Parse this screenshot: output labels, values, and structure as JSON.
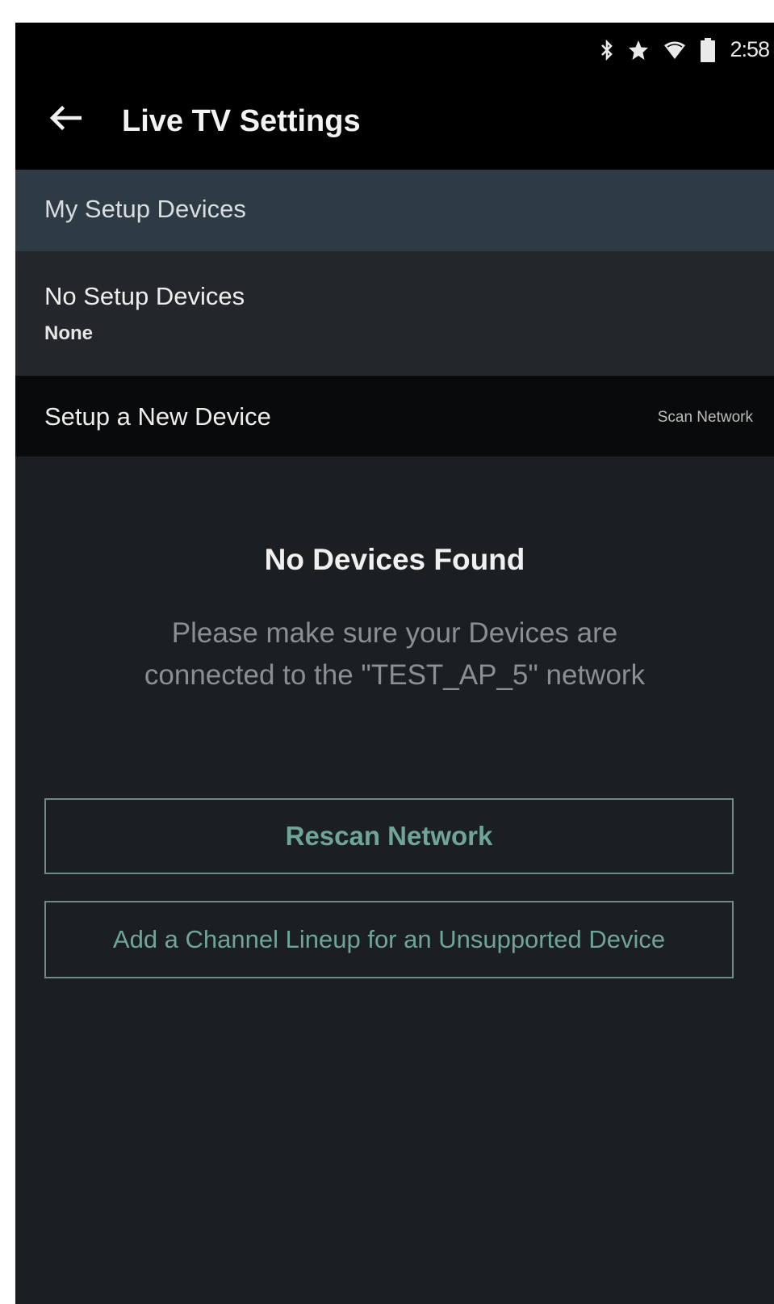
{
  "status_bar": {
    "time": "2:58",
    "icons": [
      "bluetooth-icon",
      "star-icon",
      "wifi-icon",
      "battery-icon"
    ]
  },
  "app_bar": {
    "back_icon": "arrow-left-icon",
    "title": "Live TV Settings"
  },
  "section": {
    "header": "My Setup Devices"
  },
  "device_row": {
    "primary": "No Setup Devices",
    "secondary": "None"
  },
  "new_device_row": {
    "label": "Setup a New Device",
    "action": "Scan Network"
  },
  "empty_state": {
    "title": "No Devices Found",
    "message": "Please make sure your Devices are connected to the \"TEST_AP_5\" network"
  },
  "buttons": {
    "rescan": "Rescan Network",
    "add_lineup": "Add a Channel Lineup for an Unsupported Device"
  },
  "colors": {
    "background": "#1b1f22",
    "bar": "#000000",
    "section_header": "#2e3a44",
    "accent": "#6fa597"
  }
}
